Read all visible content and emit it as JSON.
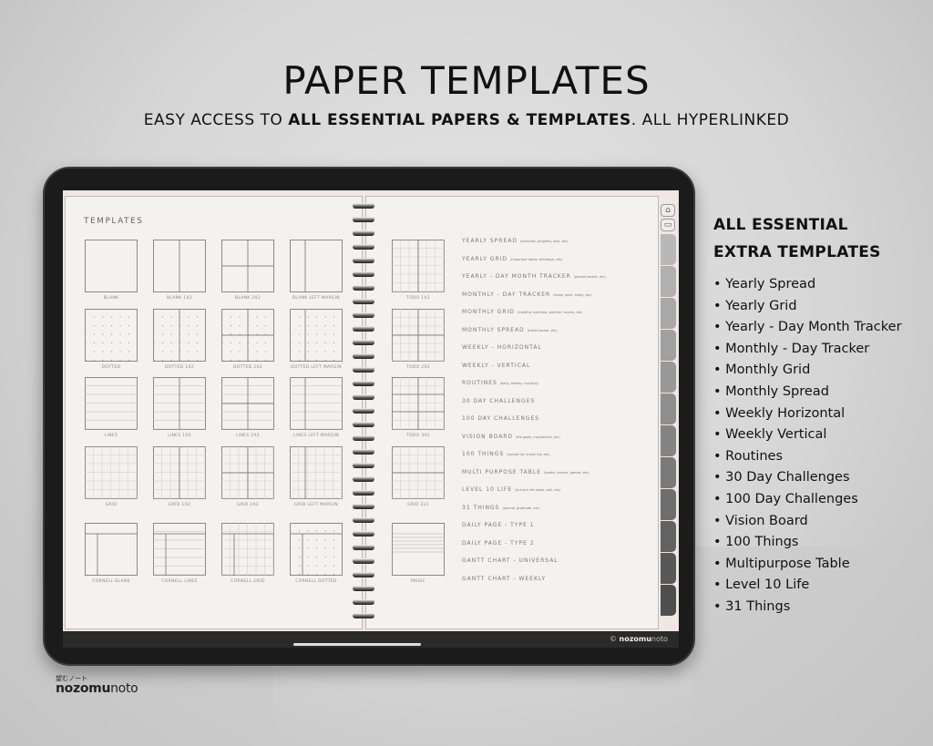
{
  "header": {
    "title": "PAPER TEMPLATES",
    "subtitle_pre": "EASY ACCESS TO ",
    "subtitle_bold": "ALL ESSENTIAL PAPERS & TEMPLATES",
    "subtitle_post": ". ALL HYPERLINKED"
  },
  "left_page": {
    "heading": "TEMPLATES",
    "thumbnails": [
      {
        "label": "BLANK",
        "layout": "single",
        "pattern": "none"
      },
      {
        "label": "BLANK 1X2",
        "layout": "split",
        "pattern": "none"
      },
      {
        "label": "BLANK 2X2",
        "layout": "quad",
        "pattern": "none"
      },
      {
        "label": "BLANK LEFT MARGIN",
        "layout": "margin",
        "pattern": "none"
      },
      {
        "label": "DOTTED",
        "layout": "single",
        "pattern": "dots"
      },
      {
        "label": "DOTTED 1X2",
        "layout": "split",
        "pattern": "dots"
      },
      {
        "label": "DOTTED 2X2",
        "layout": "quad",
        "pattern": "dots"
      },
      {
        "label": "DOTTED LEFT MARGIN",
        "layout": "margin",
        "pattern": "dots"
      },
      {
        "label": "LINES",
        "layout": "single",
        "pattern": "lines"
      },
      {
        "label": "LINES 1X2",
        "layout": "split",
        "pattern": "lines"
      },
      {
        "label": "LINES 2X2",
        "layout": "quad",
        "pattern": "lines"
      },
      {
        "label": "LINES LEFT MARGIN",
        "layout": "margin",
        "pattern": "lines"
      },
      {
        "label": "GRID",
        "layout": "single",
        "pattern": "grid"
      },
      {
        "label": "GRID 1X2",
        "layout": "split",
        "pattern": "grid"
      },
      {
        "label": "GRID 2X2",
        "layout": "quad",
        "pattern": "grid"
      },
      {
        "label": "GRID LEFT MARGIN",
        "layout": "margin",
        "pattern": "grid"
      },
      {
        "label": "CORNELL BLANK",
        "layout": "cornell",
        "pattern": "none"
      },
      {
        "label": "CORNELL LINES",
        "layout": "cornell",
        "pattern": "lines"
      },
      {
        "label": "CORNELL GRID",
        "layout": "cornell",
        "pattern": "grid"
      },
      {
        "label": "CORNELL DOTTED",
        "layout": "cornell",
        "pattern": "dots"
      }
    ]
  },
  "right_page": {
    "thumbnails": [
      {
        "label": "TODO 1X2",
        "layout": "split",
        "pattern": "grid"
      },
      {
        "label": "TODO 2X2",
        "layout": "quad",
        "pattern": "grid"
      },
      {
        "label": "TODO 3X2",
        "layout": "six",
        "pattern": "grid"
      },
      {
        "label": "GRID 2x1",
        "layout": "hsplit",
        "pattern": "grid"
      },
      {
        "label": "MUSIC",
        "layout": "single",
        "pattern": "music"
      }
    ],
    "list": [
      {
        "label": "YEARLY SPREAD",
        "note": "(checklist, progress, bills, etc)"
      },
      {
        "label": "YEARLY GRID",
        "note": "(important dates, birthdays, etc)"
      },
      {
        "label": "YEARLY - DAY MONTH TRACKER",
        "note": "(period tracker, etc)"
      },
      {
        "label": "MONTHLY - DAY TRACKER",
        "note": "(sleep, work, study, etc)"
      },
      {
        "label": "MONTHLY GRID",
        "note": "(monthly overview, planner, events, etc)"
      },
      {
        "label": "MONTHLY SPREAD",
        "note": "(habit tracker, etc)"
      },
      {
        "label": "WEEKLY - HORIZONTAL",
        "note": ""
      },
      {
        "label": "WEEKLY - VERTICAL",
        "note": ""
      },
      {
        "label": "ROUTINES",
        "note": "(daily, weekly, monthly)"
      },
      {
        "label": "30 DAY CHALLENGES",
        "note": ""
      },
      {
        "label": "100 DAY CHALLENGES",
        "note": ""
      },
      {
        "label": "VISION BOARD",
        "note": "(life goals, inspirations, etc)"
      },
      {
        "label": "100 THINGS",
        "note": "(bucket list, travel list, etc)"
      },
      {
        "label": "MULTI PURPOSE TABLE",
        "note": "(books, movies, games, etc)"
      },
      {
        "label": "LEVEL 10 LIFE",
        "note": "(to track life areas, skill, etc)"
      },
      {
        "label": "31 THINGS",
        "note": "(journal, gratitude, etc)"
      },
      {
        "label": "DAILY PAGE - TYPE 1",
        "note": ""
      },
      {
        "label": "DAILY PAGE - TYPE 2",
        "note": ""
      },
      {
        "label": "GANTT CHART - UNIVERSAL",
        "note": ""
      },
      {
        "label": "GANTT CHART - WEEKLY",
        "note": ""
      }
    ]
  },
  "tabs": {
    "count": 12,
    "colors": [
      "#b8b8b8",
      "#b0b0b0",
      "#a8a8a8",
      "#a0a0a0",
      "#989898",
      "#8e8e8e",
      "#848484",
      "#7a7a7a",
      "#6e6e6e",
      "#626262",
      "#585858",
      "#4e4e4e"
    ]
  },
  "tablet": {
    "copyright_symbol": "©",
    "copyright_bold": "nozomu",
    "copyright_light": "noto"
  },
  "side": {
    "heading_line1": "ALL ESSENTIAL",
    "heading_line2": "EXTRA TEMPLATES",
    "items": [
      "Yearly Spread",
      "Yearly Grid",
      "Yearly - Day Month Tracker",
      "Monthly - Day Tracker",
      "Monthly Grid",
      "Monthly Spread",
      "Weekly Horizontal",
      "Weekly Vertical",
      "Routines",
      "30 Day Challenges",
      "100 Day Challenges",
      "Vision Board",
      "100 Things",
      "Multipurpose Table",
      "Level 10 Life",
      "31 Things"
    ]
  },
  "brand": {
    "jp": "望むノート",
    "bold": "nozomu",
    "light": "noto"
  }
}
